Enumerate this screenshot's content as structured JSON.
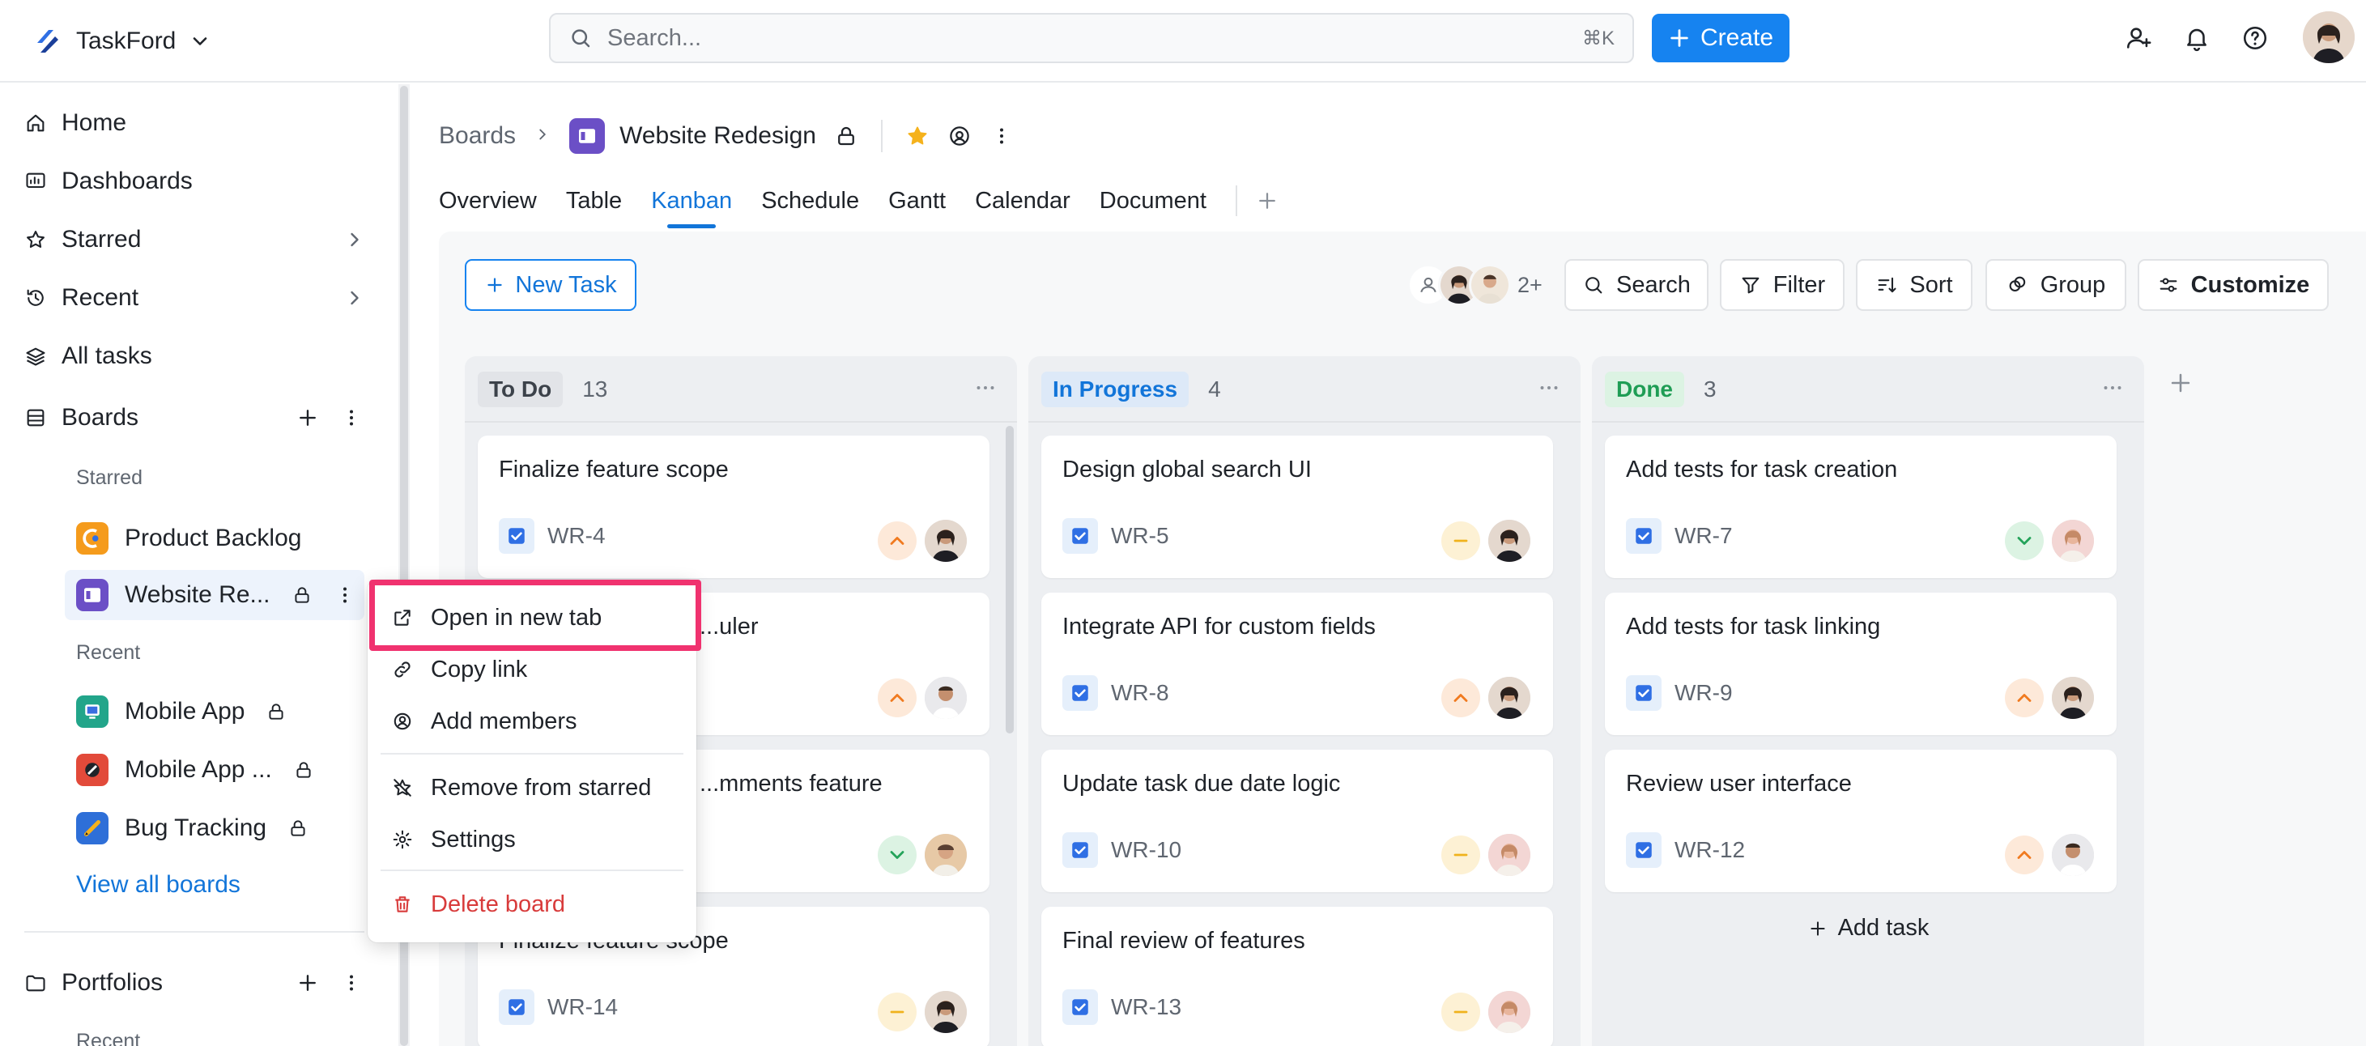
{
  "app": {
    "name": "TaskFord",
    "search_placeholder": "Search...",
    "search_shortcut": "⌘K",
    "create_label": "Create"
  },
  "sidebar": {
    "nav": [
      {
        "label": "Home",
        "icon": "home-icon"
      },
      {
        "label": "Dashboards",
        "icon": "dashboard-icon"
      },
      {
        "label": "Starred",
        "icon": "star-icon"
      },
      {
        "label": "Recent",
        "icon": "history-icon"
      },
      {
        "label": "All tasks",
        "icon": "layers-icon"
      }
    ],
    "boards_label": "Boards",
    "starred_section": "Starred",
    "starred_boards": [
      {
        "label": "Product Backlog"
      },
      {
        "label": "Website Re..."
      }
    ],
    "recent_section": "Recent",
    "recent_boards": [
      {
        "label": "Mobile App"
      },
      {
        "label": "Mobile App ..."
      },
      {
        "label": "Bug Tracking"
      }
    ],
    "view_all": "View all boards",
    "portfolios_label": "Portfolios",
    "portfolios_recent": "Recent"
  },
  "breadcrumb": {
    "root": "Boards",
    "board": "Website Redesign"
  },
  "tabs": [
    {
      "label": "Overview"
    },
    {
      "label": "Table"
    },
    {
      "label": "Kanban",
      "active": true
    },
    {
      "label": "Schedule"
    },
    {
      "label": "Gantt"
    },
    {
      "label": "Calendar"
    },
    {
      "label": "Document"
    }
  ],
  "toolbar": {
    "new_task": "New Task",
    "members_more": "2+",
    "search": "Search",
    "filter": "Filter",
    "sort": "Sort",
    "group": "Group",
    "customize": "Customize"
  },
  "columns": [
    {
      "name": "To Do",
      "count": "13",
      "color": "#5f6670",
      "cards": [
        {
          "title": "Finalize feature scope",
          "id": "WR-4",
          "priority": "high"
        },
        {
          "title": "...uler",
          "id": "",
          "priority": "high"
        },
        {
          "title": "...mments feature",
          "id": "",
          "priority": "low"
        },
        {
          "title": "Finalize feature scope",
          "id": "WR-14",
          "priority": "medium"
        }
      ]
    },
    {
      "name": "In Progress",
      "count": "4",
      "color": "#1275d9",
      "cards": [
        {
          "title": "Design global search UI",
          "id": "WR-5",
          "priority": "medium"
        },
        {
          "title": "Integrate API for custom fields",
          "id": "WR-8",
          "priority": "high"
        },
        {
          "title": "Update task due date logic",
          "id": "WR-10",
          "priority": "medium"
        },
        {
          "title": "Final review of features",
          "id": "WR-13",
          "priority": "medium"
        }
      ]
    },
    {
      "name": "Done",
      "count": "3",
      "color": "#1f9d55",
      "cards": [
        {
          "title": "Add tests for task creation",
          "id": "WR-7",
          "priority": "low"
        },
        {
          "title": "Add tests for task linking",
          "id": "WR-9",
          "priority": "high"
        },
        {
          "title": "Review user interface",
          "id": "WR-12",
          "priority": "high"
        }
      ],
      "add_task": "Add task"
    }
  ],
  "context_menu": {
    "items": [
      {
        "label": "Open in new tab",
        "icon": "external-link-icon"
      },
      {
        "label": "Copy link",
        "icon": "link-icon"
      },
      {
        "label": "Add members",
        "icon": "add-member-icon"
      },
      {
        "label": "Remove from starred",
        "icon": "star-off-icon"
      },
      {
        "label": "Settings",
        "icon": "gear-icon"
      },
      {
        "label": "Delete board",
        "icon": "trash-icon"
      }
    ]
  },
  "colors": {
    "accent": "#1683f0",
    "highlight": "#f0326f",
    "danger": "#d83b3b"
  }
}
